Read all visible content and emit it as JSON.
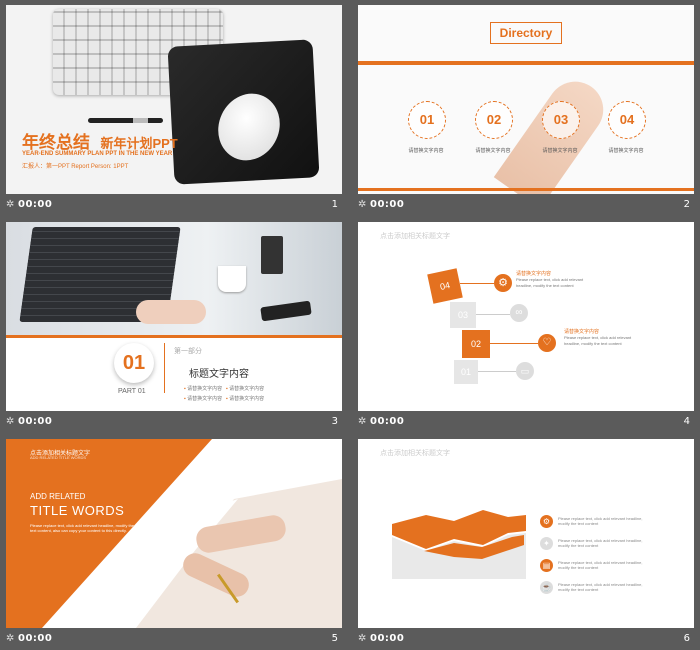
{
  "accent": "#e4711f",
  "time_label": "00:00",
  "slides": [
    {
      "number": "1",
      "title_main": "年终总结",
      "title_sub": "新年计划PPT",
      "subtitle_en": "YEAR-END SUMMARY PLAN PPT IN THE NEW YEAR",
      "reporter": "汇报人：第一PPT  Report Person: 1PPT"
    },
    {
      "number": "2",
      "heading": "Directory",
      "items": [
        {
          "num": "01",
          "label": "请替换文字内容"
        },
        {
          "num": "02",
          "label": "请替换文字内容"
        },
        {
          "num": "03",
          "label": "请替换文字内容"
        },
        {
          "num": "04",
          "label": "请替换文字内容"
        }
      ]
    },
    {
      "number": "3",
      "big_num": "01",
      "part": "PART 01",
      "section_label": "第一部分",
      "content_title": "标题文字内容",
      "bullets": [
        "请替换文字内容",
        "请替换文字内容",
        "请替换文字内容",
        "请替换文字内容"
      ]
    },
    {
      "number": "4",
      "header": "点击添加相关标题文字",
      "steps": [
        "04",
        "03",
        "02",
        "01"
      ],
      "text_title": "请替换文字内容",
      "text_body": "Please replace text, click add relevant headline, modify the text content"
    },
    {
      "number": "5",
      "header_cn": "点击添加相关标题文字",
      "header_en": "ADD RELATED TITLE WORDS",
      "add_related": "ADD RELATED",
      "title_words": "TITLE WORDS",
      "para": "Please replace text, click add relevant headline, modify the text content, also can copy your content to this directly."
    },
    {
      "number": "6",
      "header": "点击添加相关标题文字",
      "rows": [
        "Please replace text, click add relevant headline, modify the text content",
        "Please replace text, click add relevant headline, modify the text content",
        "Please replace text, click add relevant headline, modify the text content",
        "Please replace text, click add relevant headline, modify the text content"
      ]
    }
  ]
}
